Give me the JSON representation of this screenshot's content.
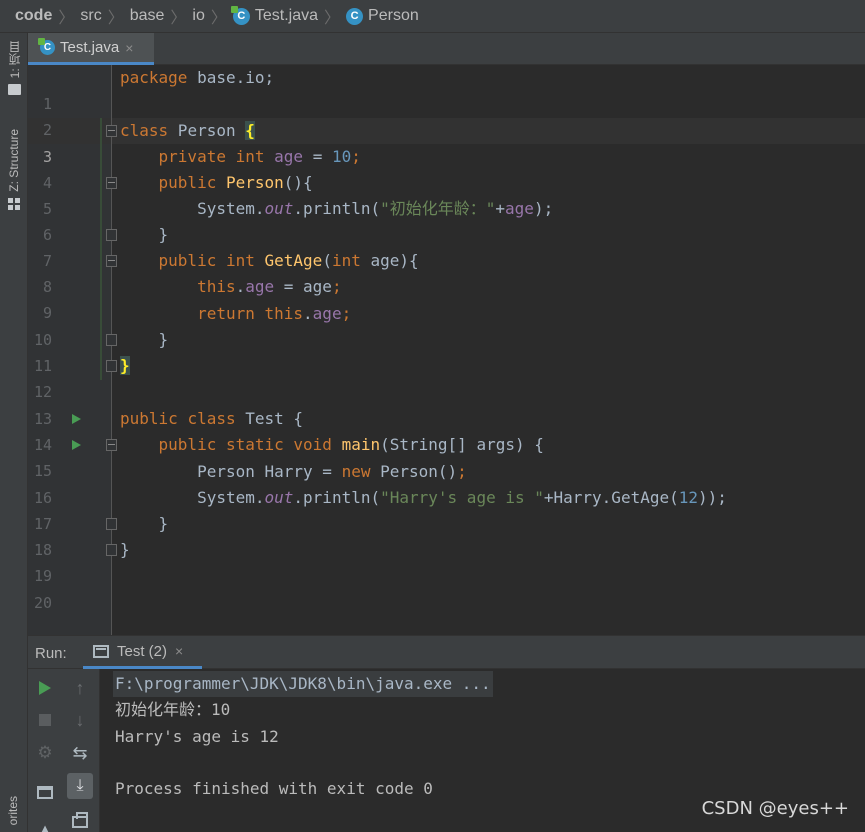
{
  "breadcrumb": {
    "items": [
      "code",
      "src",
      "base",
      "io",
      "Test.java",
      "Person"
    ]
  },
  "left_strip": {
    "project_tab": "1: 项目",
    "structure_tab": "Z: Structure",
    "favorites_tab": "orites"
  },
  "editor_tab": {
    "label": "Test.java",
    "close": "×"
  },
  "line_numbers": [
    "1",
    "2",
    "3",
    "4",
    "5",
    "6",
    "7",
    "8",
    "9",
    "10",
    "11",
    "12",
    "13",
    "14",
    "15",
    "16",
    "17",
    "18",
    "19",
    "20"
  ],
  "code": {
    "l1_kw": "package",
    "l1_rest": " base.io;",
    "l3_kw": "class",
    "l3_name": " Person ",
    "l3_brace": "{",
    "l4_kw1": "private",
    "l4_kw2": "int",
    "l4_fld": "age",
    "l4_eq": " = ",
    "l4_num": "10",
    "l4_semi": ";",
    "l5_kw": "public",
    "l5_mth": "Person",
    "l5_rest": "(){",
    "l6_a": "System.",
    "l6_out": "out",
    "l6_b": ".println(",
    "l6_str": "\"初始化年龄：\"",
    "l6_c": "+",
    "l6_fld": "age",
    "l6_d": ");",
    "l7": "}",
    "l8_kw1": "public",
    "l8_kw2": "int",
    "l8_mth": "GetAge",
    "l8_a": "(",
    "l8_kw3": "int",
    "l8_b": " age){",
    "l9_kw": "this",
    "l9_dot": ".",
    "l9_fld": "age",
    "l9_rest": " = age",
    "l9_semi": ";",
    "l10_kw1": "return",
    "l10_kw2": "this",
    "l10_dot": ".",
    "l10_fld": "age",
    "l10_semi": ";",
    "l11": "}",
    "l12_brace": "}",
    "l14_kw1": "public",
    "l14_kw2": "class",
    "l14_rest": " Test {",
    "l15_kw1": "public",
    "l15_kw2": "static",
    "l15_kw3": "void",
    "l15_mth": "main",
    "l15_rest": "(String[] args) {",
    "l16_a": "Person Harry = ",
    "l16_kw": "new",
    "l16_b": " Person()",
    "l16_semi": ";",
    "l17_a": "System.",
    "l17_out": "out",
    "l17_b": ".println(",
    "l17_str": "\"Harry's age is \"",
    "l17_c": "+Harry.GetAge(",
    "l17_num": "12",
    "l17_d": "));",
    "l18": "}",
    "l19": "}"
  },
  "run_panel": {
    "label": "Run:",
    "tab": "Test (2)",
    "close": "×"
  },
  "console": {
    "lines": [
      "F:\\programmer\\JDK\\JDK8\\bin\\java.exe ...",
      "初始化年龄：10",
      "Harry's age is 12",
      "",
      "Process finished with exit code 0"
    ]
  },
  "watermark": "CSDN @eyes++",
  "colors": {
    "keyword": "#cc7832",
    "number": "#6897bb",
    "string": "#6a8759",
    "field": "#9876aa",
    "method": "#ffc66d",
    "text": "#a9b7c6",
    "background": "#2b2b2b",
    "run_green": "#499c54"
  }
}
